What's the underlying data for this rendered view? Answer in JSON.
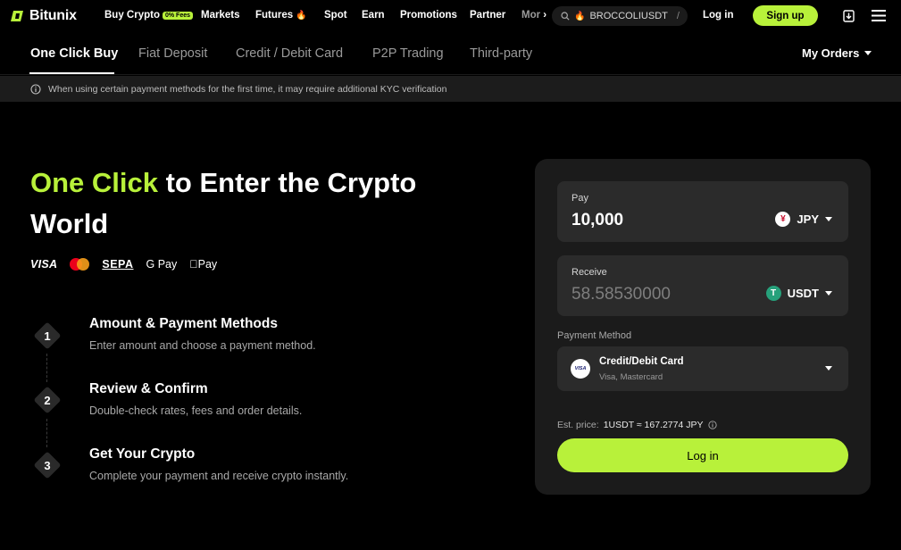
{
  "brand": {
    "name": "Bitunix"
  },
  "topnav": {
    "items": [
      {
        "label": "Buy Crypto",
        "badge": "0% Fees"
      },
      {
        "label": "Markets"
      },
      {
        "label": "Futures",
        "icon": "fire-icon"
      },
      {
        "label": "Spot"
      },
      {
        "label": "Earn"
      },
      {
        "label": "Promotions"
      },
      {
        "label": "Partner"
      },
      {
        "label": "Mor"
      }
    ],
    "search": {
      "value": "BROCCOLIUSDT",
      "shortcut": "/"
    },
    "login": "Log in",
    "signup": "Sign up"
  },
  "subnav": {
    "tabs": [
      {
        "label": "One Click Buy",
        "active": true
      },
      {
        "label": "Fiat Deposit"
      },
      {
        "label": "Credit / Debit Card"
      },
      {
        "label": "P2P Trading"
      },
      {
        "label": "Third-party"
      }
    ],
    "my_orders": "My Orders"
  },
  "notice": {
    "text": "When using certain payment methods for the first time, it may require additional KYC verification"
  },
  "hero": {
    "accent": "One Click",
    "line1_rest": " to Enter the Crypto",
    "line2": "World",
    "payment_logos": [
      "VISA",
      "Mastercard",
      "SEPA",
      "G Pay",
      "Pay"
    ]
  },
  "steps": [
    {
      "num": "1",
      "title": "Amount & Payment Methods",
      "desc": "Enter amount and choose a payment method."
    },
    {
      "num": "2",
      "title": "Review & Confirm",
      "desc": "Double-check rates, fees and order details."
    },
    {
      "num": "3",
      "title": "Get Your Crypto",
      "desc": "Complete your payment and receive crypto instantly."
    }
  ],
  "form": {
    "pay": {
      "label": "Pay",
      "value": "10,000",
      "currency": "JPY",
      "currency_symbol": "¥"
    },
    "receive": {
      "label": "Receive",
      "value": "58.58530000",
      "currency": "USDT",
      "currency_symbol": "T"
    },
    "payment_method": {
      "label": "Payment Method",
      "title": "Credit/Debit Card",
      "sub": "Visa, Mastercard",
      "badge": "VISA"
    },
    "est_price": {
      "label": "Est. price:",
      "value": "1USDT ≈ 167.2774 JPY"
    },
    "button": "Log in"
  },
  "colors": {
    "accent": "#b8f13a",
    "background": "#000000",
    "card": "#1b1b1b",
    "field": "#2b2b2b"
  }
}
